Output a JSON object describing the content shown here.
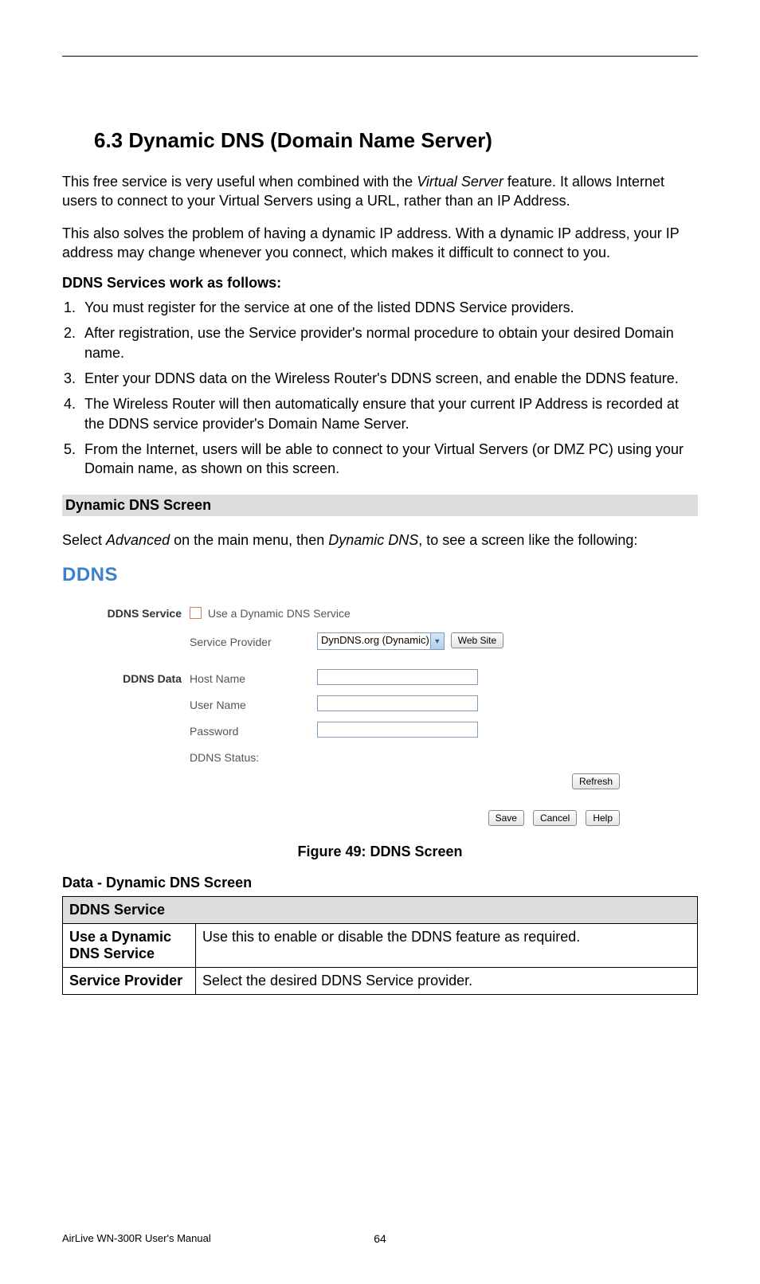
{
  "heading": "6.3  Dynamic DNS (Domain Name Server)",
  "para1_a": "This free service is very useful when combined with the ",
  "para1_em": "Virtual Server",
  "para1_b": " feature. It allows Internet users to connect to your Virtual Servers using a URL, rather than an IP Address.",
  "para2": "This also solves the problem of having a dynamic IP address. With a dynamic IP address, your IP address may change whenever you connect, which makes it difficult to connect to you.",
  "lead": "DDNS Services work as follows:",
  "steps": [
    "You must register for the service at one of the listed DDNS Service providers.",
    "After registration, use the Service provider's normal procedure to obtain your desired Domain name.",
    "Enter your DDNS data on the Wireless Router's DDNS screen, and enable the DDNS feature.",
    "The Wireless Router will then automatically ensure that your current IP Address is recorded at the DDNS service provider's Domain Name Server.",
    "From the Internet, users will be able to connect to your Virtual Servers (or DMZ PC) using your Domain name, as shown on this screen."
  ],
  "subhead1": "Dynamic DNS Screen",
  "para3_a": "Select ",
  "para3_em1": "Advanced",
  "para3_b": " on the main menu, then ",
  "para3_em2": "Dynamic DNS",
  "para3_c": ", to see a screen like the following:",
  "shot": {
    "title": "DDNS",
    "section1": "DDNS Service",
    "checkbox_label": "Use a Dynamic DNS Service",
    "sp_label": "Service Provider",
    "sp_value": "DynDNS.org (Dynamic)",
    "website_btn": "Web Site",
    "section2": "DDNS Data",
    "hostname_label": "Host Name",
    "username_label": "User Name",
    "password_label": "Password",
    "status_label": "DDNS Status:",
    "refresh_btn": "Refresh",
    "save_btn": "Save",
    "cancel_btn": "Cancel",
    "help_btn": "Help"
  },
  "figure_caption": "Figure 49: DDNS Screen",
  "data_heading": "Data - Dynamic DNS Screen",
  "table": {
    "section": "DDNS Service",
    "rows": [
      {
        "label": "Use a Dynamic DNS Service",
        "desc": "Use this to enable or disable the DDNS feature as required."
      },
      {
        "label": "Service Provider",
        "desc": "Select the desired DDNS Service provider."
      }
    ]
  },
  "footer_left": "AirLive WN-300R User's Manual",
  "page_number": "64"
}
